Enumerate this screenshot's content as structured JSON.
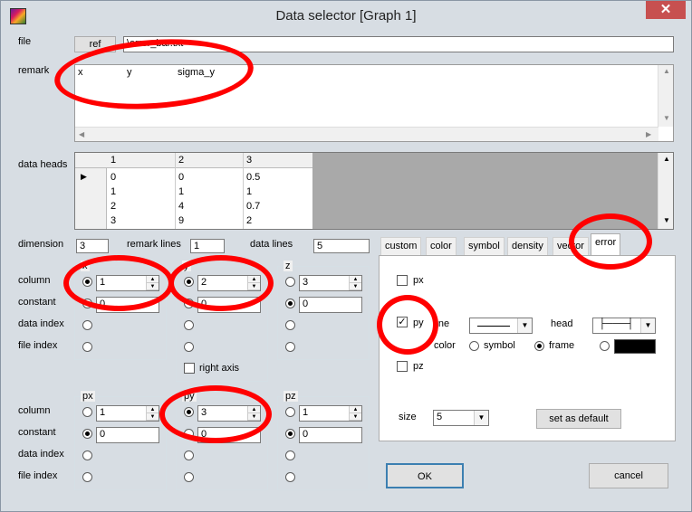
{
  "window": {
    "title": "Data selector [Graph 1]",
    "close": "✕"
  },
  "file": {
    "label": "file",
    "button": "ref",
    "path": "\\error_bar.txt"
  },
  "remark": {
    "label": "remark",
    "columns": [
      "x",
      "y",
      "sigma_y"
    ]
  },
  "data_heads": {
    "label": "data heads",
    "headers": [
      "1",
      "2",
      "3"
    ],
    "rows": [
      [
        "0",
        "0",
        "0.5"
      ],
      [
        "1",
        "1",
        "1"
      ],
      [
        "2",
        "4",
        "0.7"
      ],
      [
        "3",
        "9",
        "2"
      ]
    ]
  },
  "dimension": {
    "label": "dimension",
    "value": "3"
  },
  "remark_lines": {
    "label": "remark lines",
    "value": "1"
  },
  "data_lines": {
    "label": "data lines",
    "value": "5"
  },
  "row_labels": {
    "column": "column",
    "constant": "constant",
    "data_index": "data index",
    "file_index": "file index"
  },
  "groups_top": [
    {
      "title": "x",
      "column": "1",
      "constant": "0"
    },
    {
      "title": "y",
      "column": "2",
      "constant": "0",
      "right_axis": "right axis"
    },
    {
      "title": "z",
      "column": "3",
      "constant": "0"
    }
  ],
  "groups_bottom": [
    {
      "title": "px",
      "column": "1",
      "constant": "0"
    },
    {
      "title": "py",
      "column": "3",
      "constant": "0"
    },
    {
      "title": "pz",
      "column": "1",
      "constant": "0"
    }
  ],
  "tabs": [
    "custom",
    "color",
    "symbol",
    "density",
    "vector",
    "error"
  ],
  "error_panel": {
    "px": "px",
    "py": "py",
    "pz": "pz",
    "line": "line",
    "head": "head",
    "color": "color",
    "color_symbol": "symbol",
    "color_frame": "frame",
    "size_label": "size",
    "size_value": "5",
    "set_default": "set as default"
  },
  "ok": "OK",
  "cancel": "cancel"
}
